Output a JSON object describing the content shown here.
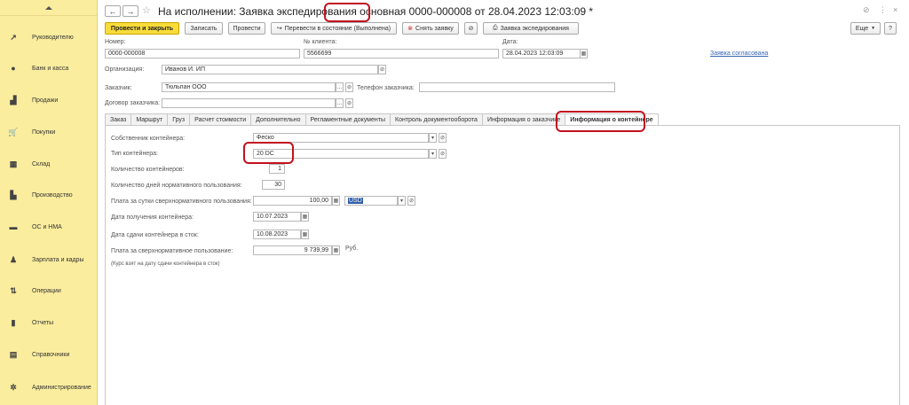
{
  "sidebar": {
    "items": [
      {
        "label": "Руководителю",
        "icon": "chart-icon"
      },
      {
        "label": "Банк и касса",
        "icon": "coin-icon"
      },
      {
        "label": "Продажи",
        "icon": "bag-icon"
      },
      {
        "label": "Покупки",
        "icon": "cart-icon"
      },
      {
        "label": "Склад",
        "icon": "warehouse-icon"
      },
      {
        "label": "Производство",
        "icon": "factory-icon"
      },
      {
        "label": "ОС и НМА",
        "icon": "truck-icon"
      },
      {
        "label": "Зарплата и кадры",
        "icon": "person-icon"
      },
      {
        "label": "Операции",
        "icon": "operations-icon"
      },
      {
        "label": "Отчеты",
        "icon": "report-icon"
      },
      {
        "label": "Справочники",
        "icon": "book-icon"
      },
      {
        "label": "Администрирование",
        "icon": "gear-icon"
      }
    ]
  },
  "header": {
    "title_prefix": "На исполнении: Заявка экспедирования ",
    "title_highlight": "основная",
    "title_suffix": " 0000-000008 от 28.04.2023 12:03:09 *",
    "back": "←",
    "forward": "→",
    "star": "☆",
    "link_icon": "⊘",
    "more_icon": "⋮",
    "close_icon": "×"
  },
  "toolbar": {
    "post_close": "Провести и закрыть",
    "save": "Записать",
    "post": "Провести",
    "change_state": "Перевести в состояние (Выполнена)",
    "cancel_request": "Снять заявку",
    "print": "Заявка экспедирования",
    "more": "Еще",
    "help": "?"
  },
  "fields": {
    "number_label": "Номер:",
    "number": "0000-000008",
    "client_no_label": "№ клиента:",
    "client_no": "5566699",
    "date_label": "Дата:",
    "date": "28.04.2023 12:03:09",
    "approved_link": "Заявка согласована",
    "org_label": "Организация:",
    "org": "Иванов И. ИП",
    "customer_label": "Заказчик:",
    "customer": "Тюльпан ООО",
    "phone_label": "Телефон заказчика:",
    "phone": "",
    "contract_label": "Договор заказчика:",
    "contract": ""
  },
  "tabs": [
    "Заказ",
    "Маршрут",
    "Груз",
    "Расчет стоимости",
    "Дополнительно",
    "Регламентные документы",
    "Контроль документооборота",
    "Информация о заказчике",
    "Информация о контейнере"
  ],
  "container": {
    "owner_label": "Собственник контейнера:",
    "owner": "Феско",
    "type_label": "Тип контейнера:",
    "type": "20 DC",
    "count_label": "Количество контейнеров:",
    "count": "1",
    "days_label": "Количество дней нормативного пользования:",
    "days": "30",
    "fee_label": "Плата за сутки сверхнормативного пользования:",
    "fee": "100,00",
    "currency": "USD",
    "received_label": "Дата получения контейнера:",
    "received": "10.07.2023",
    "returned_label": "Дата сдачи контейнера в сток:",
    "returned": "10.08.2023",
    "overuse_label": "Плата за сверхнормативное пользование:",
    "overuse": "9 739,99",
    "overuse_unit": "Руб.",
    "rate_note": "(Курс взят на дату сдачи контейнера в сток)"
  },
  "colors": {
    "sidebar_bg": "#fbed9e",
    "primary_button": "#f9dc3a",
    "highlight_border": "#c1121f",
    "link": "#3a66b3"
  }
}
